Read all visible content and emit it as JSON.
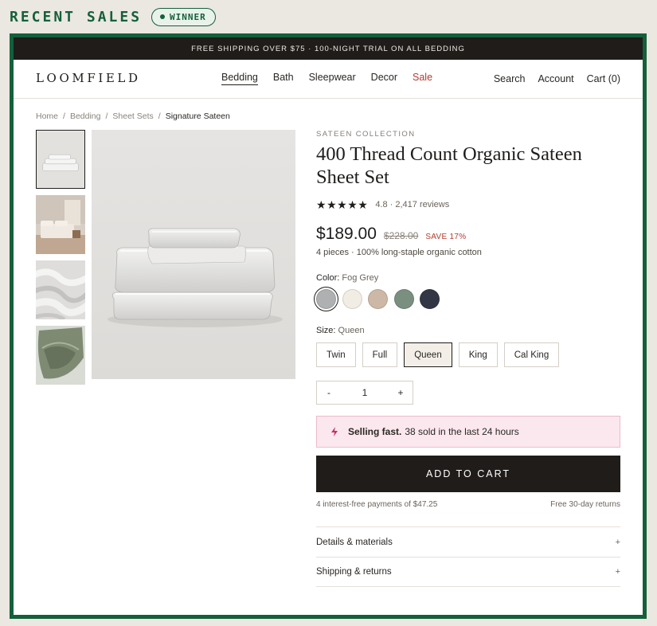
{
  "outer": {
    "title": "RECENT SALES",
    "badge": "WINNER",
    "accent": "#14603a"
  },
  "promo": {
    "text": "FREE SHIPPING OVER $75 · 100-NIGHT TRIAL ON ALL BEDDING"
  },
  "nav": {
    "logo": "LOOMFIELD",
    "links": [
      {
        "label": "Bedding",
        "active": true
      },
      {
        "label": "Bath"
      },
      {
        "label": "Sleepwear"
      },
      {
        "label": "Decor"
      },
      {
        "label": "Sale",
        "sale": true
      }
    ],
    "search": "Search",
    "account": "Account",
    "cart": "Cart (0)"
  },
  "breadcrumb": {
    "items": [
      "Home",
      "Bedding",
      "Sheet Sets"
    ],
    "current": "Signature Sateen"
  },
  "product": {
    "collection": "SATEEN COLLECTION",
    "title": "400 Thread Count Organic Sateen Sheet Set",
    "rating": "4.8 · 2,417 reviews",
    "stars": 5,
    "price": "$189.00",
    "compare_price": "$228.00",
    "save": "SAVE 17%",
    "spec": "4 pieces · 100% long-staple organic cotton",
    "color_label": "Color:",
    "color_value": "Fog Grey",
    "colors": [
      "#aeb0b1",
      "#f1ece4",
      "#cdb8a5",
      "#7a8f7f",
      "#333745"
    ],
    "selected_color_index": 0,
    "size_label": "Size:",
    "size_value": "Queen",
    "sizes": [
      "Twin",
      "Full",
      "Queen",
      "King",
      "Cal King"
    ],
    "selected_size_index": 2,
    "qty": {
      "minus": "-",
      "value": "1",
      "plus": "+"
    },
    "alert_strong": "Selling fast.",
    "alert_text": "38 sold in the last 24 hours",
    "add_to_cart": "ADD TO CART",
    "installments": "4 interest-free payments of $47.25",
    "returns": "Free 30-day returns",
    "accordions": [
      {
        "label": "Details & materials",
        "icon": "+"
      },
      {
        "label": "Shipping & returns",
        "icon": "+"
      }
    ]
  }
}
